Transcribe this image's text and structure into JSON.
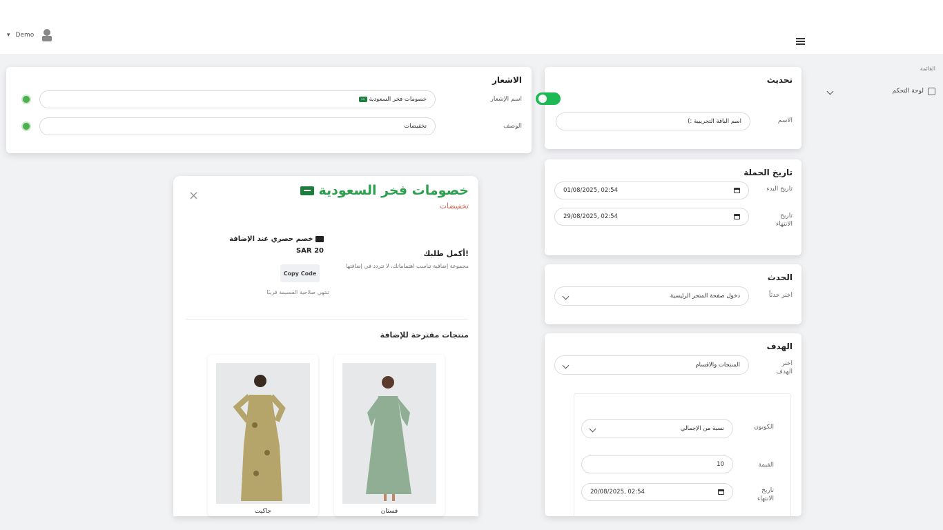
{
  "header": {
    "user_label": "Demo",
    "user_caret": "▾"
  },
  "sidebar": {
    "heading": "القائمة",
    "items": [
      {
        "label": "لوحة التحكم",
        "icon": "home-icon"
      }
    ]
  },
  "update_card": {
    "title": "تحديث",
    "toggle_on": true,
    "name_label": "الاسم",
    "name_value": "اسم الباقة التجريبية :)"
  },
  "campaign_date": {
    "title": "تاريخ الحملة",
    "start_label": "تاريخ البدء",
    "start_value": "01/08/2025, 02:54",
    "end_label": "تاريخ الانتهاء",
    "end_value": "29/08/2025, 02:54"
  },
  "event_card": {
    "title": "الحدث",
    "label": "اختر حدثاً",
    "value": "دخول صفحة المتجر الرئيسية"
  },
  "target_card": {
    "title": "الهدف",
    "label": "اختر الهدف",
    "value": "المنتجات والاقسام",
    "coupon": {
      "type_label": "الكوبون",
      "type_value": "نسبة من الإجمالي",
      "amount_label": "القيمة",
      "amount_value": "10",
      "expiry_label": "تاريخ الانتهاء",
      "expiry_value": "20/08/2025, 02:54"
    }
  },
  "notification_card": {
    "title": "الاشعار",
    "name_label": "اسم الإشعار",
    "name_value": "خصومات فخر السعودية",
    "desc_label": "الوصف",
    "desc_value": "تخفيضات"
  },
  "preview": {
    "title": "خصومات فخر السعودية",
    "subtitle": "تخفيضات",
    "close": "×",
    "complete_title": "أكمل طلبك!",
    "complete_desc": "مجموعة إضافية تناسب اهتماماتك، لا تتردد في إضافتها",
    "discount_title": "خصم حصري عند الإضافة",
    "discount_amount": "SAR 20",
    "copy_button": "Copy Code",
    "expiry_note": "تنتهي صلاحية القسيمة قريبًا",
    "suggested_title": "منتجات مقترحة للإضافة",
    "products": [
      {
        "name": "فستان"
      },
      {
        "name": "جاكيت"
      }
    ]
  },
  "colors": {
    "accent": "#2e9e4f",
    "toggle": "#1db954",
    "gear": "#4caf50"
  }
}
